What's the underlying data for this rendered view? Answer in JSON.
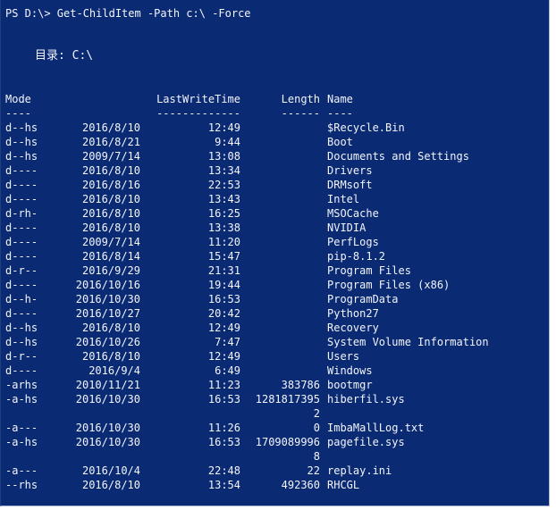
{
  "console": {
    "command_line": "PS D:\\> Get-ChildItem -Path c:\\ -Force",
    "directory_label": "目录: C:\\",
    "headers": {
      "mode": "Mode",
      "last_write_time": "LastWriteTime",
      "length": "Length",
      "name": "Name"
    },
    "underlines": {
      "mode": "----",
      "last_write_time": "-------------",
      "length": "------",
      "name": "----"
    },
    "rows": [
      {
        "mode": "d--hs",
        "date": "2016/8/10",
        "time": "12:49",
        "length": "",
        "length_wrap": "",
        "name": "$Recycle.Bin"
      },
      {
        "mode": "d--hs",
        "date": "2016/8/21",
        "time": "9:44",
        "length": "",
        "length_wrap": "",
        "name": "Boot"
      },
      {
        "mode": "d--hs",
        "date": "2009/7/14",
        "time": "13:08",
        "length": "",
        "length_wrap": "",
        "name": "Documents and Settings"
      },
      {
        "mode": "d----",
        "date": "2016/8/10",
        "time": "13:34",
        "length": "",
        "length_wrap": "",
        "name": "Drivers"
      },
      {
        "mode": "d----",
        "date": "2016/8/16",
        "time": "22:53",
        "length": "",
        "length_wrap": "",
        "name": "DRMsoft"
      },
      {
        "mode": "d----",
        "date": "2016/8/10",
        "time": "13:43",
        "length": "",
        "length_wrap": "",
        "name": "Intel"
      },
      {
        "mode": "d-rh-",
        "date": "2016/8/10",
        "time": "16:25",
        "length": "",
        "length_wrap": "",
        "name": "MSOCache"
      },
      {
        "mode": "d----",
        "date": "2016/8/10",
        "time": "13:38",
        "length": "",
        "length_wrap": "",
        "name": "NVIDIA"
      },
      {
        "mode": "d----",
        "date": "2009/7/14",
        "time": "11:20",
        "length": "",
        "length_wrap": "",
        "name": "PerfLogs"
      },
      {
        "mode": "d----",
        "date": "2016/8/14",
        "time": "15:47",
        "length": "",
        "length_wrap": "",
        "name": "pip-8.1.2"
      },
      {
        "mode": "d-r--",
        "date": "2016/9/29",
        "time": "21:31",
        "length": "",
        "length_wrap": "",
        "name": "Program Files"
      },
      {
        "mode": "d----",
        "date": "2016/10/16",
        "time": "19:44",
        "length": "",
        "length_wrap": "",
        "name": "Program Files (x86)"
      },
      {
        "mode": "d--h-",
        "date": "2016/10/30",
        "time": "16:53",
        "length": "",
        "length_wrap": "",
        "name": "ProgramData"
      },
      {
        "mode": "d----",
        "date": "2016/10/27",
        "time": "20:42",
        "length": "",
        "length_wrap": "",
        "name": "Python27"
      },
      {
        "mode": "d--hs",
        "date": "2016/8/10",
        "time": "12:49",
        "length": "",
        "length_wrap": "",
        "name": "Recovery"
      },
      {
        "mode": "d--hs",
        "date": "2016/10/26",
        "time": "7:47",
        "length": "",
        "length_wrap": "",
        "name": "System Volume Information"
      },
      {
        "mode": "d-r--",
        "date": "2016/8/10",
        "time": "12:49",
        "length": "",
        "length_wrap": "",
        "name": "Users"
      },
      {
        "mode": "d----",
        "date": "2016/9/4",
        "time": "6:49",
        "length": "",
        "length_wrap": "",
        "name": "Windows"
      },
      {
        "mode": "-arhs",
        "date": "2010/11/21",
        "time": "11:23",
        "length": "383786",
        "length_wrap": "",
        "name": "bootmgr"
      },
      {
        "mode": "-a-hs",
        "date": "2016/10/30",
        "time": "16:53",
        "length": "1281817395",
        "length_wrap": "2",
        "name": "hiberfil.sys"
      },
      {
        "mode": "-a---",
        "date": "2016/10/30",
        "time": "11:26",
        "length": "0",
        "length_wrap": "",
        "name": "ImbaMallLog.txt"
      },
      {
        "mode": "-a-hs",
        "date": "2016/10/30",
        "time": "16:53",
        "length": "1709089996",
        "length_wrap": "8",
        "name": "pagefile.sys"
      },
      {
        "mode": "-a---",
        "date": "2016/10/4",
        "time": "22:48",
        "length": "22",
        "length_wrap": "",
        "name": "replay.ini"
      },
      {
        "mode": "--rhs",
        "date": "2016/8/10",
        "time": "13:54",
        "length": "492360",
        "length_wrap": "",
        "name": "RHCGL"
      }
    ]
  }
}
